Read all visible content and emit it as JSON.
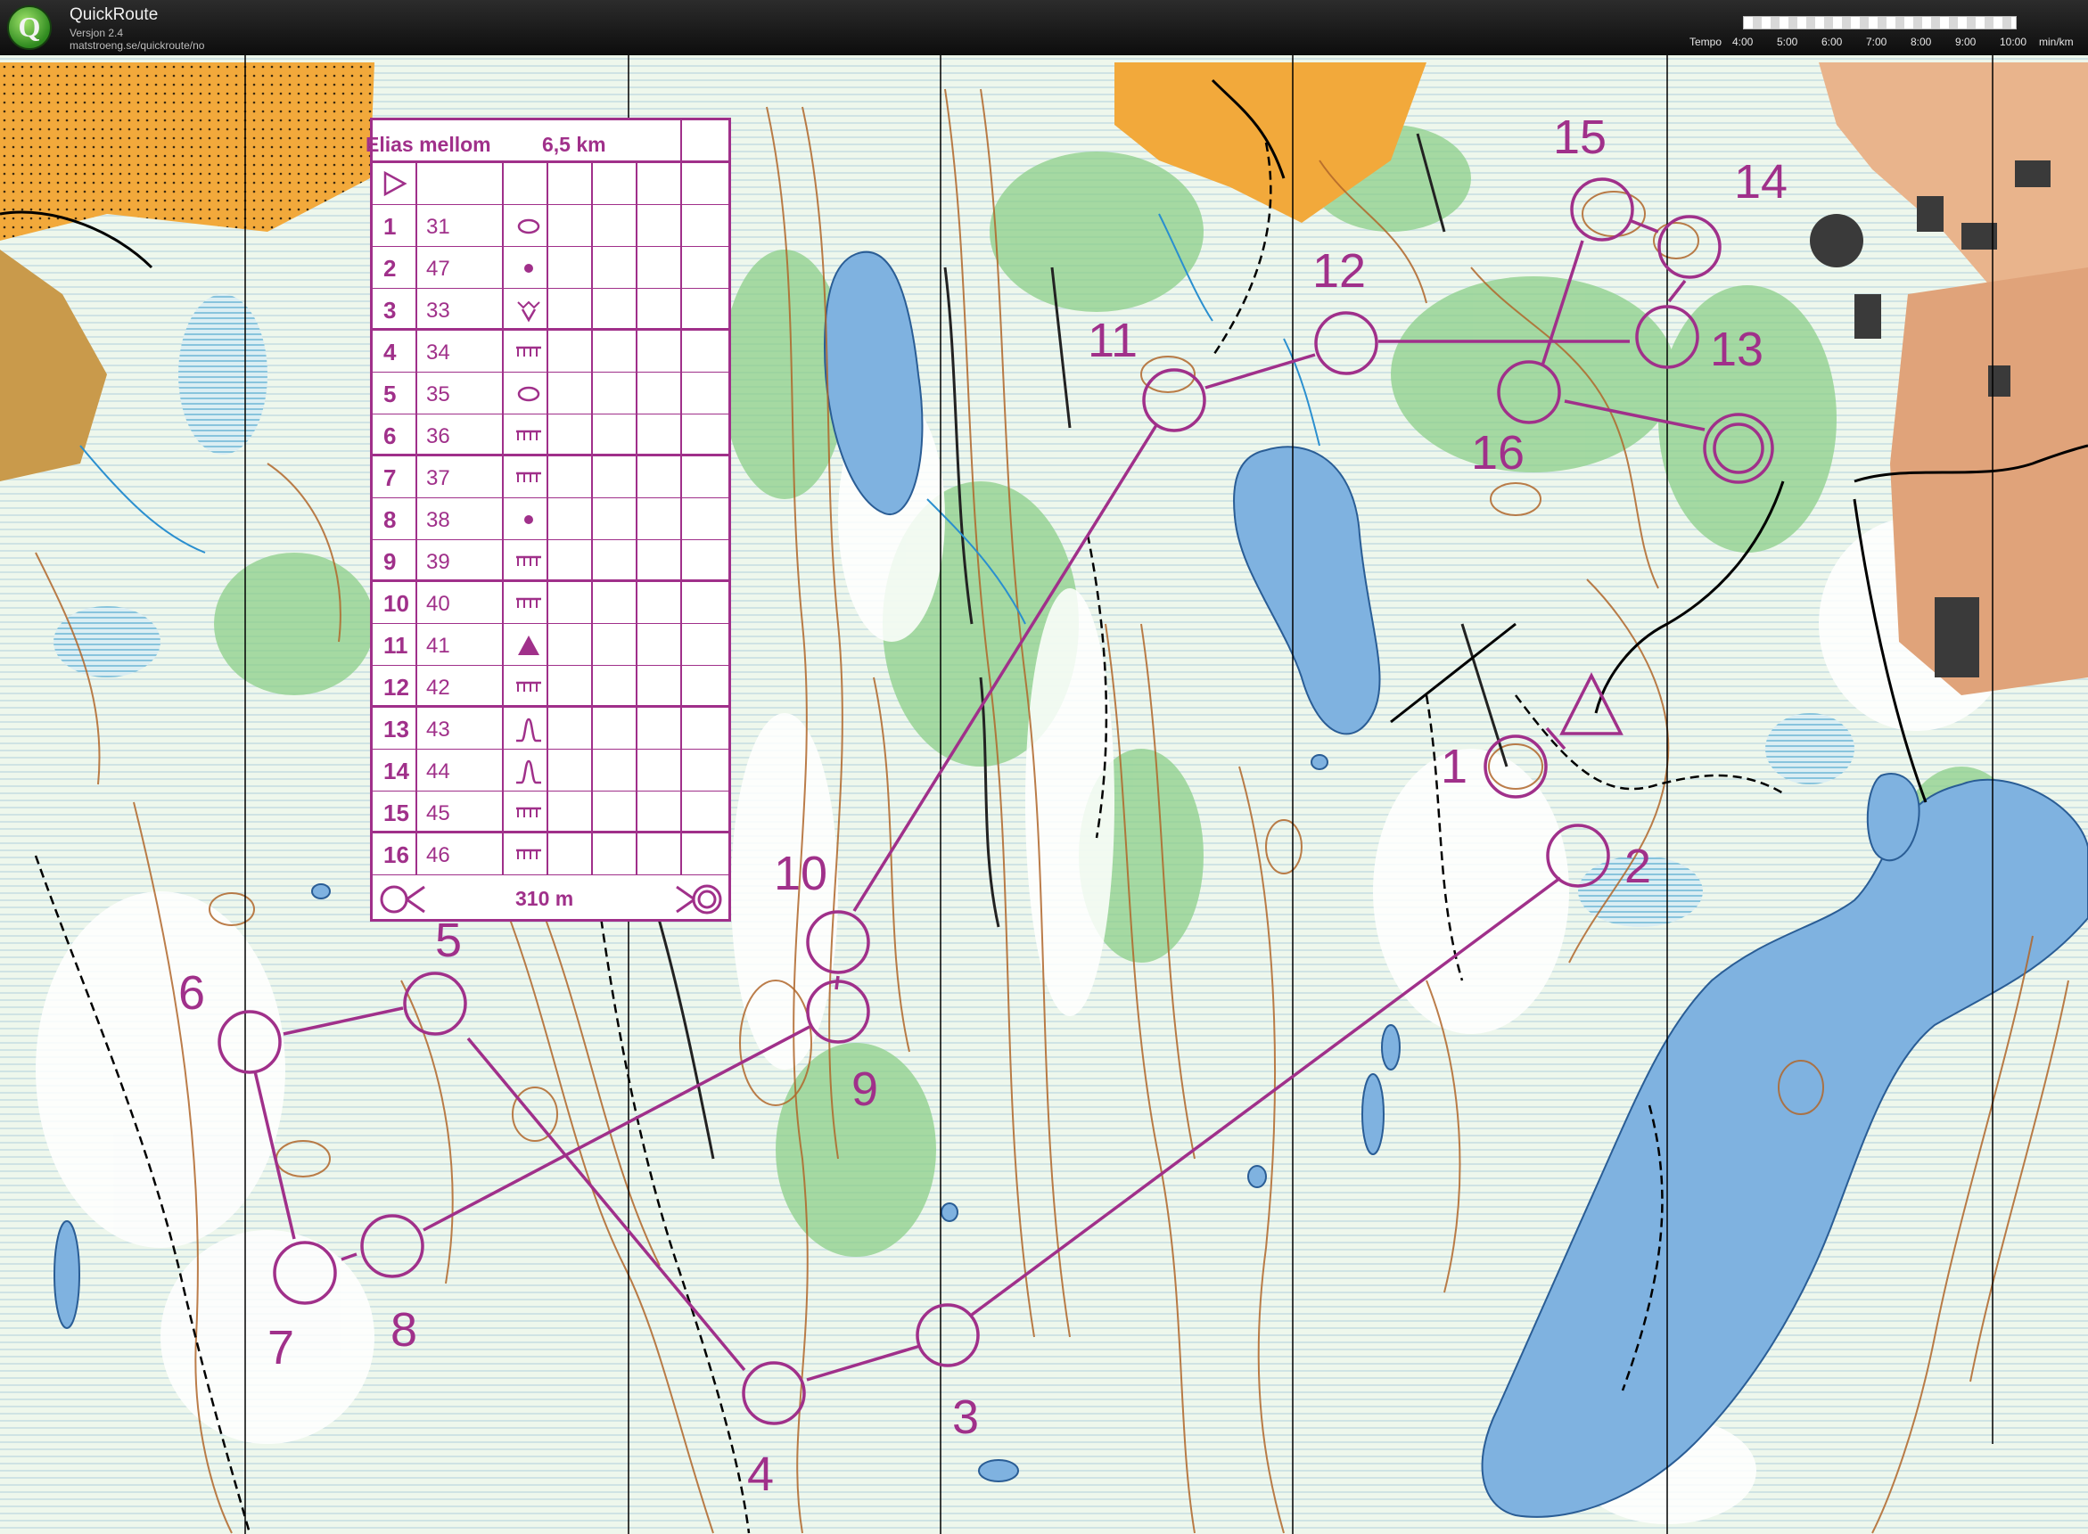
{
  "app": {
    "name": "QuickRoute",
    "version": "Versjon 2.4",
    "url": "matstroeng.se/quickroute/no",
    "logo_letter": "Q"
  },
  "tempo_scale": {
    "label": "Tempo",
    "ticks": [
      "4:00",
      "5:00",
      "6:00",
      "7:00",
      "8:00",
      "9:00",
      "10:00"
    ],
    "unit": "min/km"
  },
  "course": {
    "name": "Elias mellom",
    "length": "6,5 km",
    "final_distance": "310 m",
    "controls": [
      {
        "num": "1",
        "code": "31",
        "symbol": "ellipse"
      },
      {
        "num": "2",
        "code": "47",
        "symbol": "dot"
      },
      {
        "num": "3",
        "code": "33",
        "symbol": "depression"
      },
      {
        "num": "4",
        "code": "34",
        "symbol": "cliff"
      },
      {
        "num": "5",
        "code": "35",
        "symbol": "ellipse"
      },
      {
        "num": "6",
        "code": "36",
        "symbol": "cliff"
      },
      {
        "num": "7",
        "code": "37",
        "symbol": "cliff"
      },
      {
        "num": "8",
        "code": "38",
        "symbol": "dot"
      },
      {
        "num": "9",
        "code": "39",
        "symbol": "cliff"
      },
      {
        "num": "10",
        "code": "40",
        "symbol": "cliff"
      },
      {
        "num": "11",
        "code": "41",
        "symbol": "triangle"
      },
      {
        "num": "12",
        "code": "42",
        "symbol": "cliff"
      },
      {
        "num": "13",
        "code": "43",
        "symbol": "knoll"
      },
      {
        "num": "14",
        "code": "44",
        "symbol": "knoll"
      },
      {
        "num": "15",
        "code": "45",
        "symbol": "cliff"
      },
      {
        "num": "16",
        "code": "46",
        "symbol": "cliff"
      }
    ]
  },
  "colors": {
    "course": "#a0308a",
    "water": "#7fb2e0",
    "open_land": "#f2a93b",
    "forest_green": "#8ccf8a",
    "contour": "#b0662a",
    "rough": "#c7e6c4"
  }
}
